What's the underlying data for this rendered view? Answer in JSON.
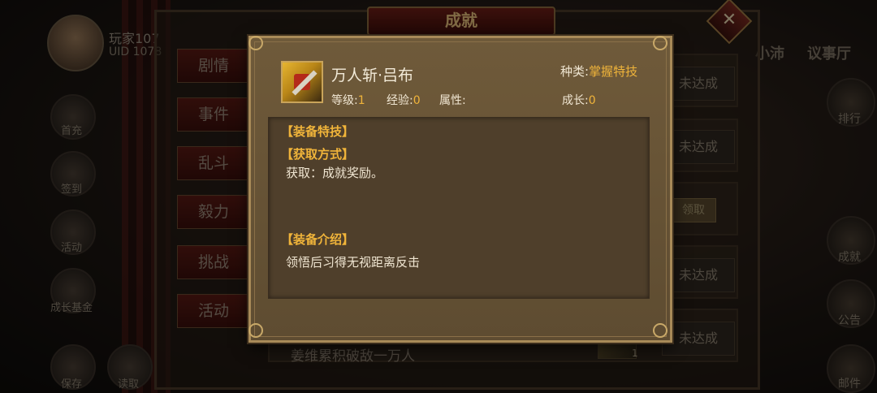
{
  "player": {
    "name": "玩家107",
    "uid": "UID 1078"
  },
  "background_panel": {
    "title": "成就",
    "close_icon": "close-icon",
    "tabs": [
      "剧情",
      "事件",
      "乱斗",
      "毅力",
      "挑战",
      "活动"
    ],
    "rows": [
      {
        "status": "未达成"
      },
      {
        "status": "未达成"
      },
      {
        "status": "领取"
      },
      {
        "status": "未达成"
      },
      {
        "status": "未达成",
        "text": "姜维累积破敌一万人",
        "item_count": "1"
      }
    ]
  },
  "top_right": {
    "left_text": "小沛",
    "right_text": "议事厅"
  },
  "left_buttons": [
    {
      "label": "首充",
      "icon": "first-charge-icon"
    },
    {
      "label": "签到",
      "icon": "sign-in-icon"
    },
    {
      "label": "活动",
      "icon": "activity-icon"
    },
    {
      "label": "成长基金",
      "icon": "growth-fund-icon"
    },
    {
      "label": "保存",
      "icon": "save-icon"
    },
    {
      "label": "读取",
      "icon": "load-icon"
    }
  ],
  "right_buttons": [
    {
      "label": "排行",
      "icon": "ranking-icon"
    },
    {
      "label": "成就",
      "icon": "achievement-icon"
    },
    {
      "label": "公告",
      "icon": "notice-icon"
    },
    {
      "label": "邮件",
      "icon": "mail-icon"
    }
  ],
  "modal": {
    "item_name": "万人斩·吕布",
    "item_icon": "sword-scroll-icon",
    "type_label": "种类:",
    "type_value": "掌握特技",
    "level_label": "等级:",
    "level_value": "1",
    "exp_label": "经验:",
    "exp_value": "0",
    "attr_label": "属性:",
    "attr_value": "",
    "growth_label": "成长:",
    "growth_value": "0",
    "sec_equip_skill": "【装备特技】",
    "sec_obtain": "【获取方式】",
    "obtain_text": "获取：成就奖励。",
    "sec_intro": "【装备介绍】",
    "intro_text": "领悟后习得无视距离反击"
  },
  "colors": {
    "accent_gold": "#f0b43a",
    "title_red": "#6d1e16"
  }
}
